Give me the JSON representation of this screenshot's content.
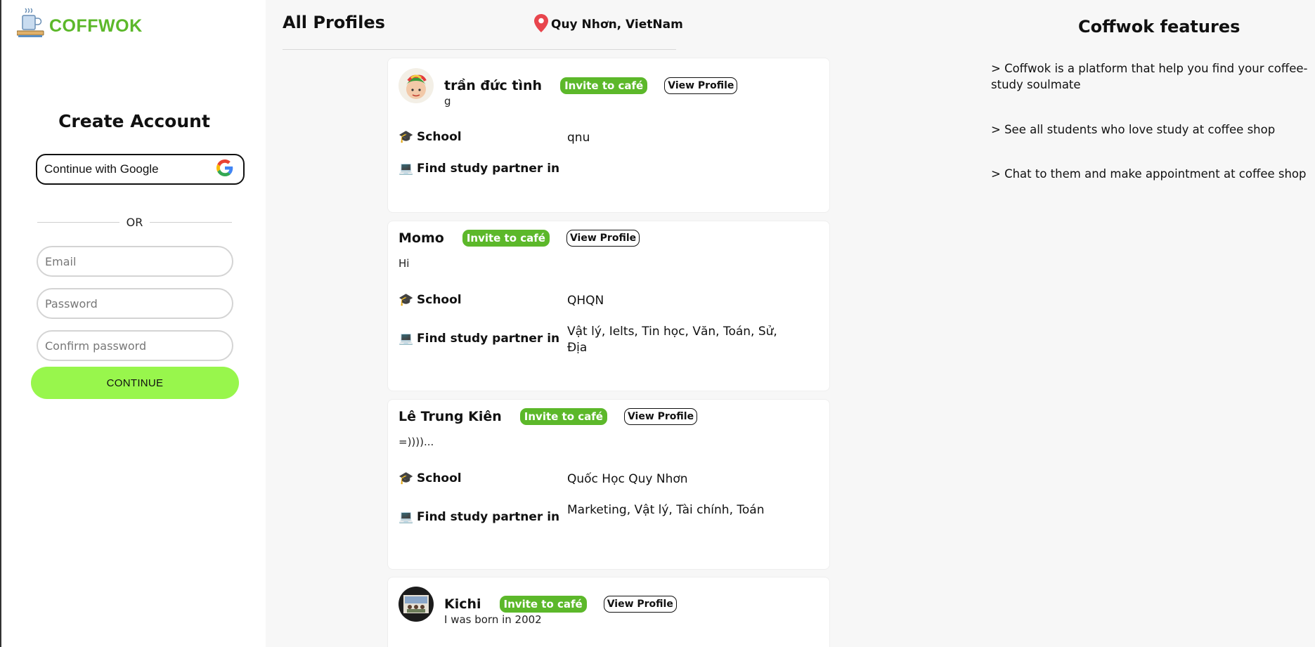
{
  "brand": {
    "name": "COFFWOK",
    "accent": "#5cb82a"
  },
  "signup": {
    "title": "Create Account",
    "google_label": "Continue with Google",
    "or_label": "OR",
    "email_placeholder": "Email",
    "password_placeholder": "Password",
    "confirm_placeholder": "Confirm password",
    "continue_label": "CONTINUE",
    "continue_color": "#98f64c"
  },
  "header": {
    "title": "All Profiles",
    "location": "Quy Nhơn, VietNam",
    "location_icon": "map-pin-icon"
  },
  "profile_labels": {
    "invite": "Invite to café",
    "view": "View Profile",
    "school": "School",
    "partner": "Find study partner in",
    "school_icon": "graduation-cap-icon",
    "partner_icon": "laptop-heart-icon"
  },
  "profiles": [
    {
      "name": "trần đức tình",
      "bio": "g",
      "school": "qnu",
      "subjects": "",
      "has_avatar": true
    },
    {
      "name": "Momo",
      "bio": "Hi",
      "school": "QHQN",
      "subjects": "Vật lý, Ielts, Tin học, Văn, Toán, Sử, Địa",
      "has_avatar": false
    },
    {
      "name": "Lê Trung Kiên",
      "bio": "=))))...",
      "school": "Quốc Học Quy Nhơn",
      "subjects": "Marketing, Vật lý, Tài chính, Toán",
      "has_avatar": false
    },
    {
      "name": "Kichi",
      "bio": "I was born in 2002",
      "school": "",
      "subjects": "",
      "has_avatar": true
    }
  ],
  "features": {
    "title": "Coffwok features",
    "items": [
      "> Coffwok is a platform that help you find your coffee-study soulmate",
      "> See all students who love study at coffee shop",
      "> Chat to them and make appointment at coffee shop"
    ]
  }
}
